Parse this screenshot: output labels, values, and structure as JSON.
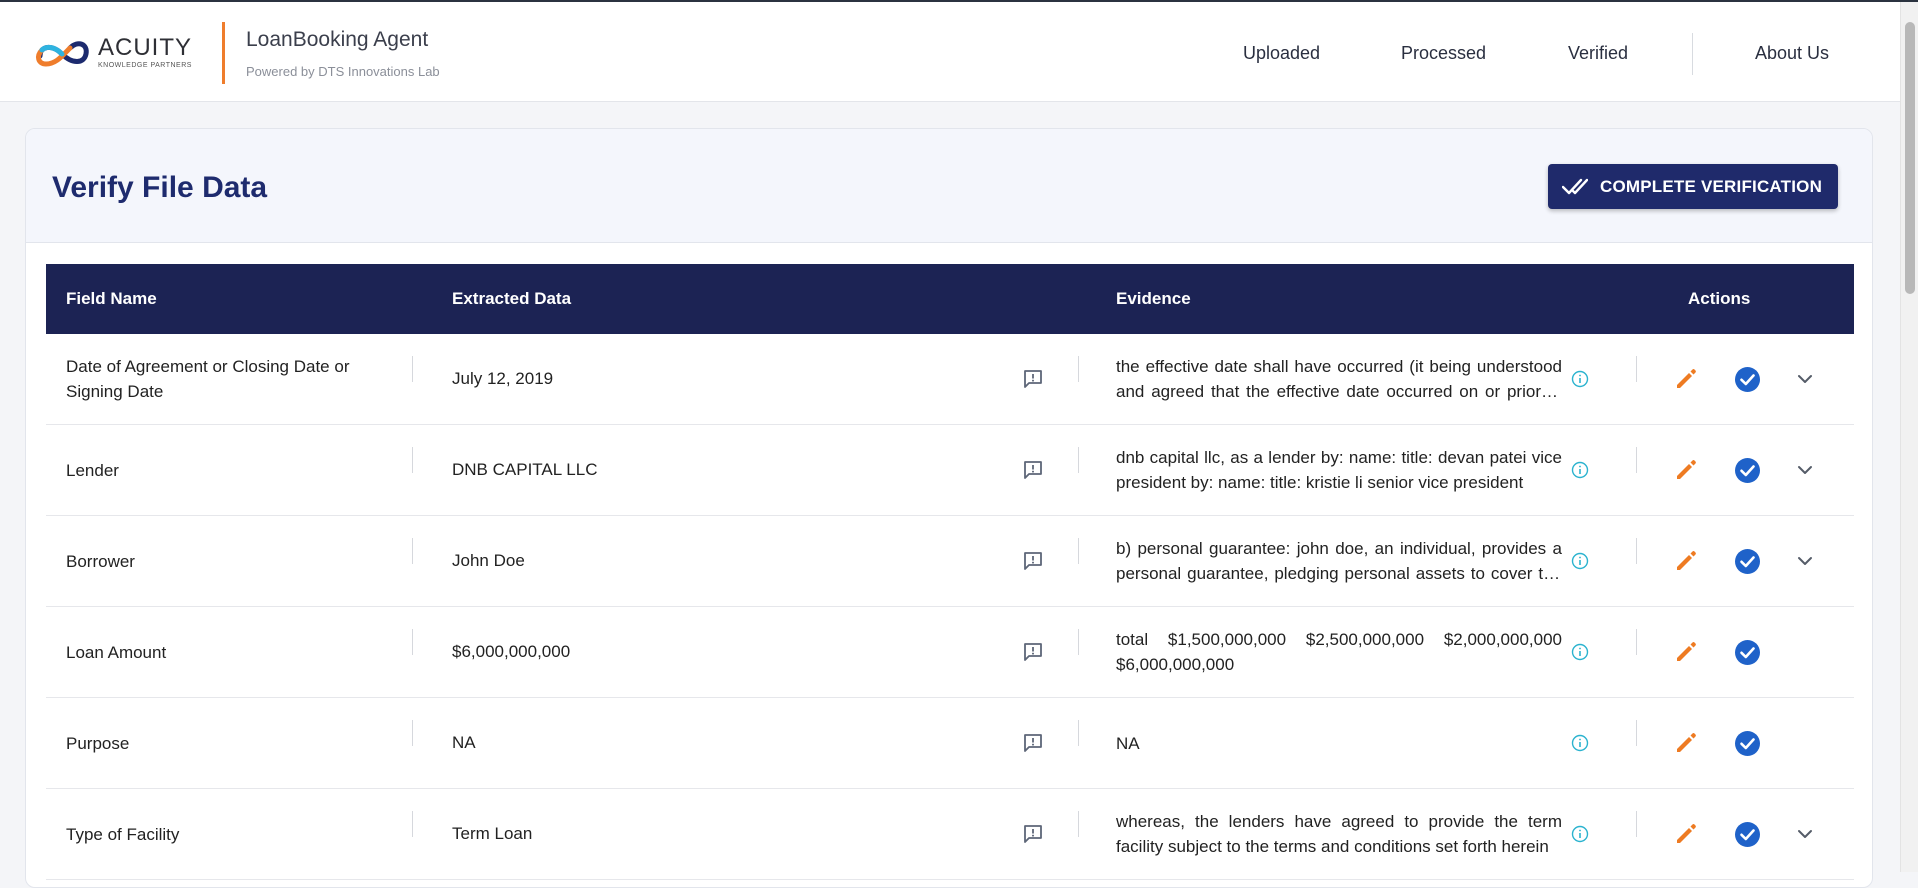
{
  "brand": {
    "logo_word": "ACUITY",
    "logo_sub": "KNOWLEDGE PARTNERS",
    "accent": "#ef7d2c",
    "navy": "#1c2354"
  },
  "app": {
    "title": "LoanBooking Agent",
    "subtitle": "Powered by DTS Innovations Lab"
  },
  "nav": {
    "uploaded": "Uploaded",
    "processed": "Processed",
    "verified": "Verified",
    "about": "About Us"
  },
  "page": {
    "title": "Verify File Data",
    "complete_button": "COMPLETE VERIFICATION"
  },
  "table": {
    "headers": {
      "field": "Field Name",
      "data": "Extracted Data",
      "evidence": "Evidence",
      "actions": "Actions"
    },
    "rows": [
      {
        "field": "Date of Agreement or Closing Date or Signing Date",
        "data": "July 12, 2019",
        "evidence": "the effective date shall have occurred (it being understood and agreed that the effective date occurred on or prior to the closing date)",
        "expandable": true
      },
      {
        "field": "Lender",
        "data": "DNB CAPITAL LLC",
        "evidence": "dnb capital llc, as a lender by: name: title: devan patei vice president by: name: title: kristie li senior vice president",
        "expandable": true
      },
      {
        "field": "Borrower",
        "data": "John Doe",
        "evidence": "b) personal guarantee: john doe, an individual, provides a personal guarantee, pledging personal assets to cover the obligations",
        "expandable": true
      },
      {
        "field": "Loan Amount",
        "data": "$6,000,000,000",
        "evidence": "total $1,500,000,000 $2,500,000,000 $2,000,000,000 $6,000,000,000",
        "expandable": false
      },
      {
        "field": "Purpose",
        "data": "NA",
        "evidence": "NA",
        "expandable": false
      },
      {
        "field": "Type of Facility",
        "data": "Term Loan",
        "evidence": "whereas, the lenders have agreed to provide the term facility subject to the terms and conditions set forth herein",
        "expandable": true
      }
    ]
  },
  "icons": {
    "comment": "comment-alert-icon",
    "info": "info-icon",
    "edit": "pencil-icon",
    "verify": "check-circle-icon",
    "expand": "chevron-down-icon",
    "complete": "double-check-icon"
  }
}
